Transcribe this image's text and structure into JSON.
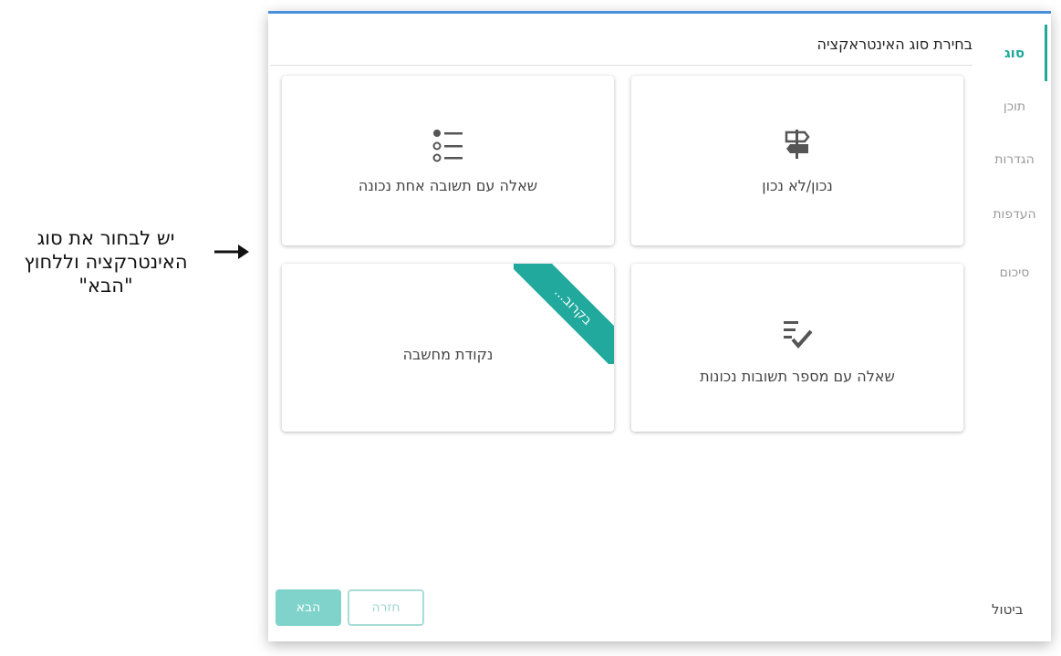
{
  "annotation": {
    "line1": "יש לבחור את סוג",
    "line2": "האינטרקציה וללחוץ",
    "line3": "\"הבא\""
  },
  "sidebar": {
    "steps": [
      {
        "label": "סוג",
        "active": true
      },
      {
        "label": "תוכן",
        "active": false
      },
      {
        "label": "הגדרות",
        "active": false
      },
      {
        "label": "העדפות",
        "active": false
      },
      {
        "label": "סיכום",
        "active": false
      }
    ]
  },
  "header": {
    "title": "בחירת סוג האינטראקציה"
  },
  "cards": [
    {
      "label": "נכון/לא נכון",
      "icon": "signpost-icon"
    },
    {
      "label": "שאלה עם תשובה אחת נכונה",
      "icon": "list-icon"
    },
    {
      "label": "שאלה עם מספר תשובות נכונות",
      "icon": "checklist-icon"
    },
    {
      "label": "נקודת מחשבה",
      "icon": "none",
      "ribbon": "בקרוב..."
    }
  ],
  "footer": {
    "next": "הבא",
    "back": "חזרה",
    "cancel": "ביטול"
  },
  "colors": {
    "accent": "#21a99e",
    "top_border": "#4a90d9"
  }
}
